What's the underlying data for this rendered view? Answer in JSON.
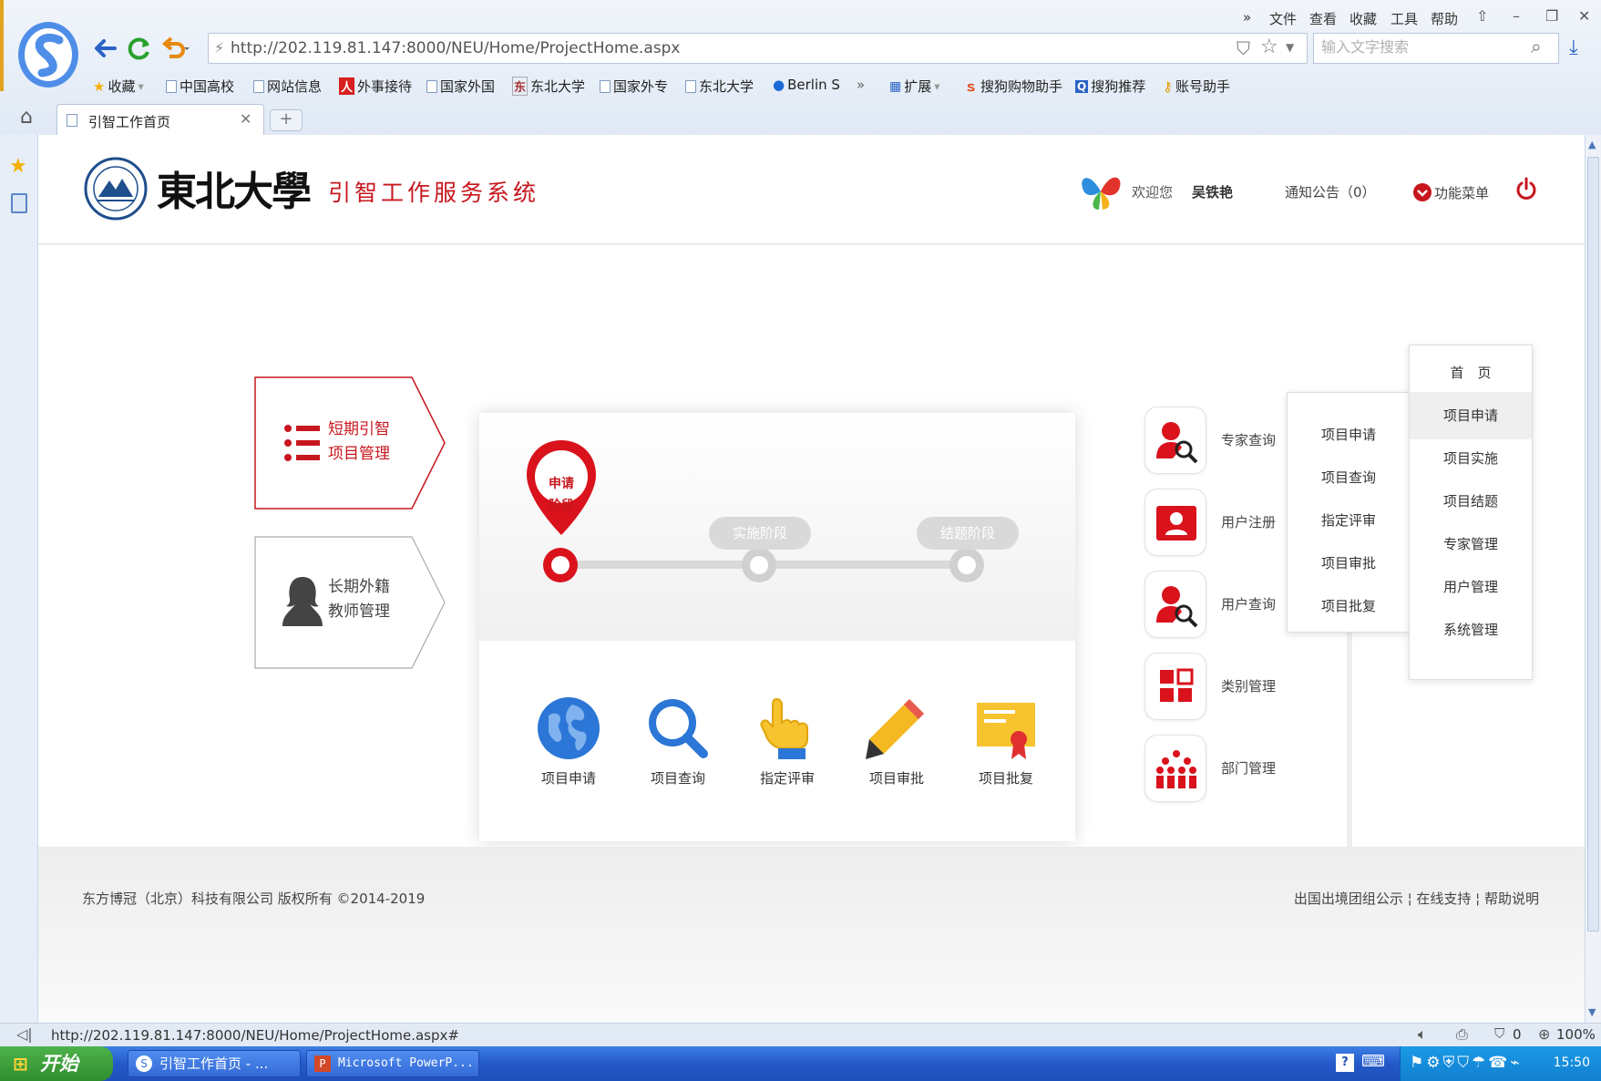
{
  "browser": {
    "menu": [
      "»",
      "文件",
      "查看",
      "收藏",
      "工具",
      "帮助"
    ],
    "address": "http://202.119.81.147:8000/NEU/Home/ProjectHome.aspx",
    "search_placeholder": "输入文字搜索",
    "bookmarks": [
      "收藏",
      "中国高校",
      "网站信息",
      "外事接待",
      "国家外国",
      "东北大学",
      "国家外专",
      "东北大学",
      "Berlin S",
      "»",
      "扩展",
      "搜狗购物助手",
      "搜狗推荐",
      "账号助手"
    ],
    "tab_title": "引智工作首页",
    "tab_new": "+",
    "status_url": "http://202.119.81.147:8000/NEU/Home/ProjectHome.aspx#",
    "status_right": [
      "0",
      "100%"
    ]
  },
  "header": {
    "university": "東北大學",
    "system_title": "引智工作服务系统",
    "welcome": "欢迎您",
    "user_name": "吴铁艳",
    "notice": "通知公告（0）",
    "function_menu": "功能菜单"
  },
  "tiles": [
    {
      "line1": "短期引智",
      "line2": "项目管理",
      "active": true
    },
    {
      "line1": "长期外籍",
      "line2": "教师管理",
      "active": false
    }
  ],
  "stages": {
    "current_line1": "申请",
    "current_line2": "阶段",
    "next": [
      "实施阶段",
      "结题阶段"
    ]
  },
  "features": [
    "项目申请",
    "项目查询",
    "指定评审",
    "项目审批",
    "项目批复"
  ],
  "quick_menu": [
    "专家查询",
    "用户注册",
    "用户查询",
    "类别管理",
    "部门管理"
  ],
  "dropdown_main": [
    "首　页",
    "项目申请",
    "项目实施",
    "项目结题",
    "专家管理",
    "用户管理",
    "系统管理"
  ],
  "dropdown_main_active": "项目申请",
  "dropdown_sub": [
    "项目申请",
    "项目查询",
    "指定评审",
    "项目审批",
    "项目批复"
  ],
  "footer": {
    "copyright": "东方博冠（北京）科技有限公司 版权所有 ©2014-2019",
    "links": "出国出境团组公示 ¦ 在线支持 ¦ 帮助说明"
  },
  "taskbar": {
    "start": "开始",
    "tasks": [
      "引智工作首页 - ...",
      "Microsoft PowerP..."
    ],
    "clock": "15:50"
  },
  "colors": {
    "brand_red": "#c7161e",
    "accent_blue": "#2b76d6"
  }
}
